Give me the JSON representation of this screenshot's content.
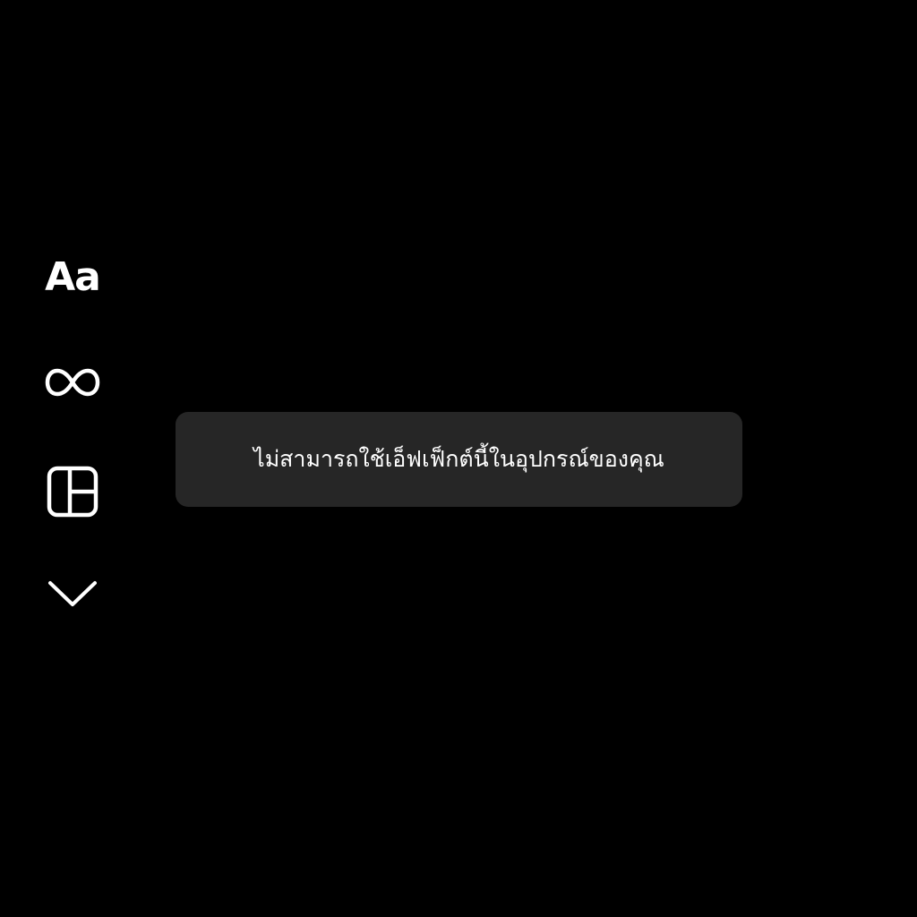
{
  "toolbar": {
    "text_tool_label": "Aa",
    "items": [
      {
        "name": "text",
        "icon": "text-aa-icon"
      },
      {
        "name": "boomerang",
        "icon": "infinity-icon"
      },
      {
        "name": "layout",
        "icon": "layout-grid-icon"
      },
      {
        "name": "more",
        "icon": "chevron-down-icon"
      }
    ]
  },
  "toast": {
    "message": "ไม่สามารถใช้เอ็ฟเฟ็กต์นี้ในอุปกรณ์ของคุณ"
  },
  "colors": {
    "background": "#000000",
    "toast_background": "#262626",
    "foreground": "#ffffff"
  }
}
